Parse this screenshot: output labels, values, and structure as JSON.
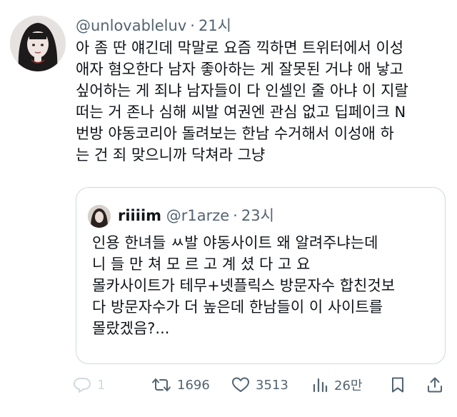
{
  "tweet": {
    "handle": "@unlovableluv",
    "separator": "·",
    "time": "21시",
    "body": "아 좀 딴 얘긴데 막말로 요즘 끽하면 트위터에서 이성\n애자 혐오한다 남자 좋아하는 게 잘못된 거냐 애 낳고\n싶어하는 게 죄냐 남자들이 다 인셀인 줄 아냐 이 지랄\n떠는 거 존나 심해 씨발 여권엔 관심 없고 딥페이크 N\n번방 야동코리아 돌려보는 한남 수거해서 이성애 하\n는 건 죄 맞으니까 닥쳐라 그냥"
  },
  "quote": {
    "name": "riiiim",
    "handle": "@r1arze",
    "separator": "·",
    "time": "23시",
    "body": "인용 한녀들 ㅆ발 야동사이트 왜 알려주냐는데\n니 들 만 쳐 모 르 고 계 셨 다 고 요\n몰카사이트가 테무+넷플릭스 방문자수 합친것보\n다 방문자수가 더 높은데 한남들이 이 사이트를\n몰랐겠음?..."
  },
  "actions": {
    "reply_count": "1",
    "retweet_count": "1696",
    "like_count": "3513",
    "views_count": "26만"
  },
  "colors": {
    "text": "#0f1419",
    "secondary": "#536471",
    "border": "#cfd9de"
  }
}
